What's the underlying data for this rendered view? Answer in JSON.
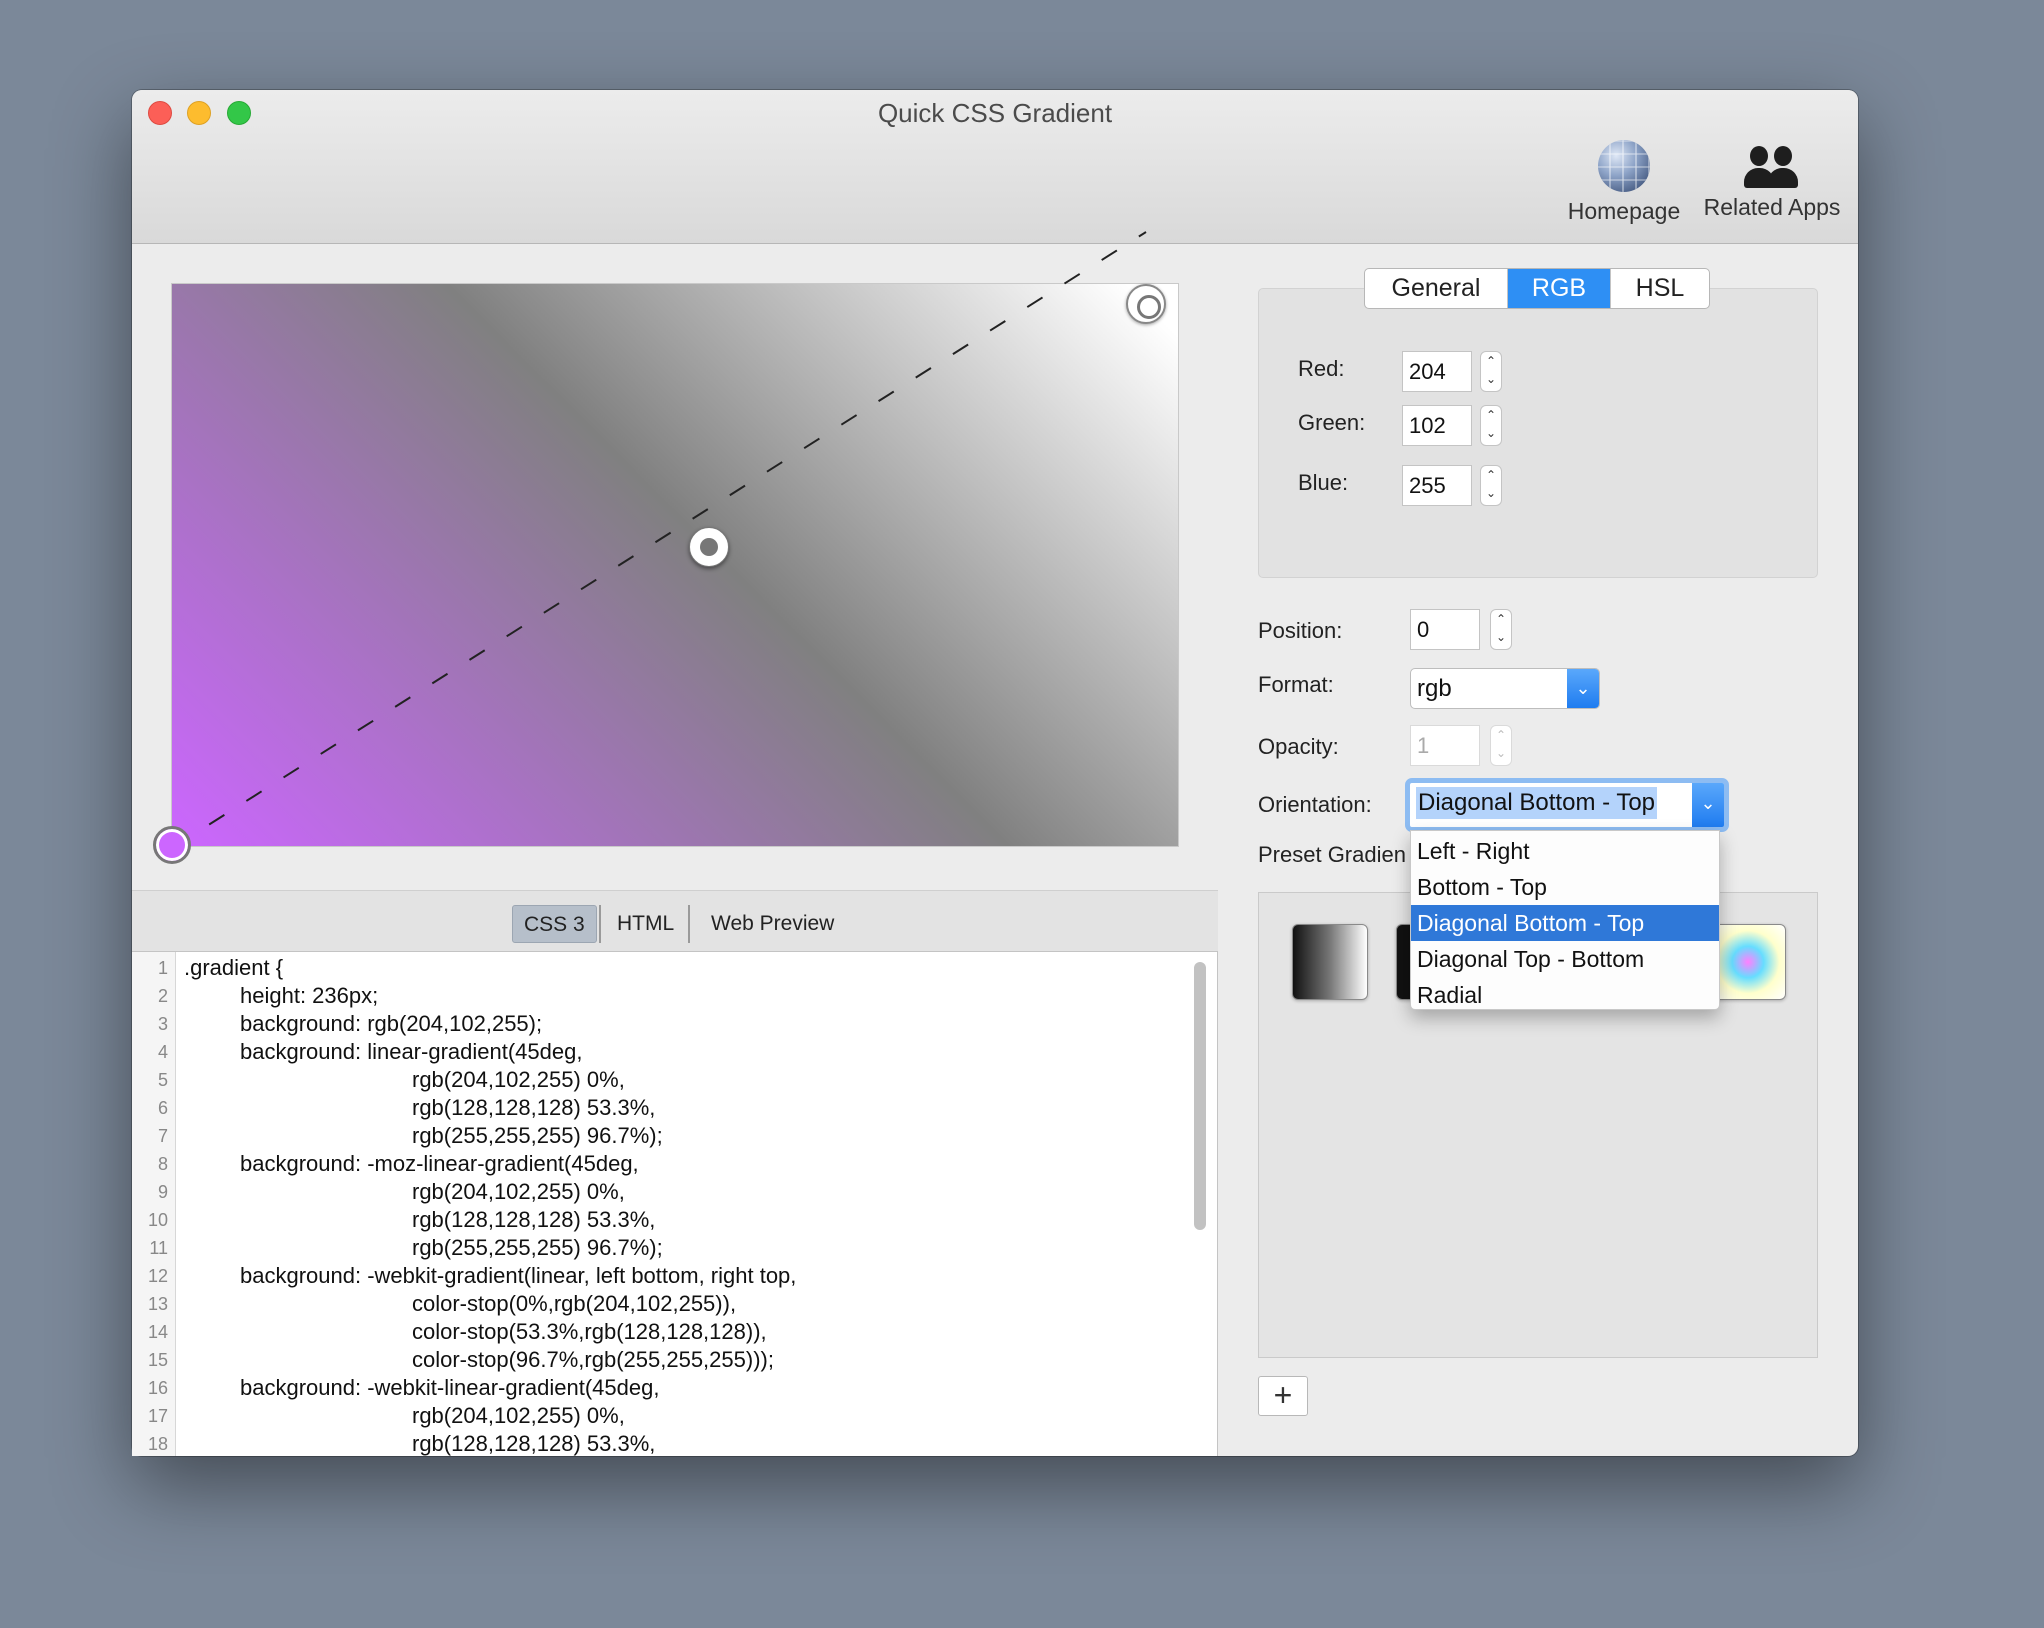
{
  "window": {
    "title": "Quick CSS Gradient"
  },
  "toolbar": {
    "homepage_label": "Homepage",
    "related_label": "Related Apps"
  },
  "code_tabs": {
    "css3": "CSS 3",
    "html": "HTML",
    "web_preview": "Web Preview",
    "active": "CSS 3"
  },
  "code_lines": [
    {
      "n": "1",
      "text": ".gradient {",
      "indent": 0
    },
    {
      "n": "2",
      "text": "height: 236px;",
      "indent": 1
    },
    {
      "n": "3",
      "text": "background: rgb(204,102,255);",
      "indent": 1
    },
    {
      "n": "4",
      "text": "background: linear-gradient(45deg,",
      "indent": 1
    },
    {
      "n": "5",
      "text": "rgb(204,102,255) 0%,",
      "indent": 2
    },
    {
      "n": "6",
      "text": "rgb(128,128,128) 53.3%,",
      "indent": 2
    },
    {
      "n": "7",
      "text": "rgb(255,255,255) 96.7%);",
      "indent": 2
    },
    {
      "n": "8",
      "text": "background: -moz-linear-gradient(45deg,",
      "indent": 1
    },
    {
      "n": "9",
      "text": "rgb(204,102,255) 0%,",
      "indent": 2
    },
    {
      "n": "10",
      "text": "rgb(128,128,128) 53.3%,",
      "indent": 2
    },
    {
      "n": "11",
      "text": "rgb(255,255,255) 96.7%);",
      "indent": 2
    },
    {
      "n": "12",
      "text": "background: -webkit-gradient(linear, left bottom, right top,",
      "indent": 1
    },
    {
      "n": "13",
      "text": "color-stop(0%,rgb(204,102,255)),",
      "indent": 2
    },
    {
      "n": "14",
      "text": "color-stop(53.3%,rgb(128,128,128)),",
      "indent": 2
    },
    {
      "n": "15",
      "text": "color-stop(96.7%,rgb(255,255,255)));",
      "indent": 2
    },
    {
      "n": "16",
      "text": "background: -webkit-linear-gradient(45deg,",
      "indent": 1
    },
    {
      "n": "17",
      "text": "rgb(204,102,255) 0%,",
      "indent": 2
    },
    {
      "n": "18",
      "text": "rgb(128,128,128) 53.3%,",
      "indent": 2
    }
  ],
  "color_tabs": {
    "general": "General",
    "rgb": "RGB",
    "hsl": "HSL",
    "active": "RGB"
  },
  "rgb": {
    "red_label": "Red:",
    "red_value": "204",
    "green_label": "Green:",
    "green_value": "102",
    "blue_label": "Blue:",
    "blue_value": "255"
  },
  "settings": {
    "position_label": "Position:",
    "position_value": "0",
    "format_label": "Format:",
    "format_value": "rgb",
    "opacity_label": "Opacity:",
    "opacity_value": "1",
    "orientation_label": "Orientation:",
    "orientation_value": "Diagonal Bottom - Top",
    "preset_label": "Preset Gradien"
  },
  "orientation_options": [
    {
      "label": "Left - Right",
      "selected": false
    },
    {
      "label": "Bottom - Top",
      "selected": false
    },
    {
      "label": "Diagonal Bottom - Top",
      "selected": true
    },
    {
      "label": "Diagonal Top - Bottom",
      "selected": false
    },
    {
      "label": "Radial",
      "selected": false
    }
  ],
  "add_button": "+",
  "colors": {
    "accent": "#2e8ff4",
    "stop_start": "#cc66ff",
    "stop_mid": "#808080",
    "stop_end": "#ffffff"
  }
}
